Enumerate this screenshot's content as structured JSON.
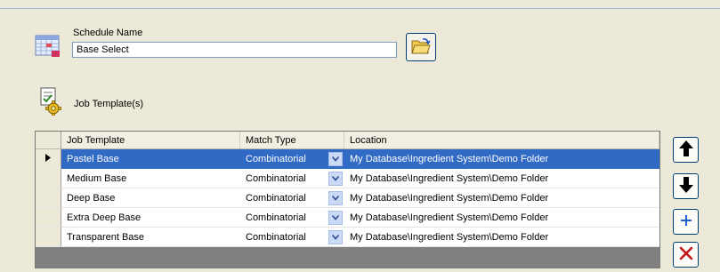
{
  "schedule": {
    "label": "Schedule Name",
    "value": "Base Select"
  },
  "job_templates": {
    "label": "Job Template(s)"
  },
  "grid": {
    "columns": [
      "Job Template",
      "Match Type",
      "Location"
    ],
    "rows": [
      {
        "template": "Pastel Base",
        "match": "Combinatorial",
        "location": "My Database\\Ingredient System\\Demo Folder",
        "selected": true
      },
      {
        "template": "Medium Base",
        "match": "Combinatorial",
        "location": "My Database\\Ingredient System\\Demo Folder",
        "selected": false
      },
      {
        "template": "Deep Base",
        "match": "Combinatorial",
        "location": "My Database\\Ingredient System\\Demo Folder",
        "selected": false
      },
      {
        "template": "Extra Deep Base",
        "match": "Combinatorial",
        "location": "My Database\\Ingredient System\\Demo Folder",
        "selected": false
      },
      {
        "template": "Transparent Base",
        "match": "Combinatorial",
        "location": "My Database\\Ingredient System\\Demo Folder",
        "selected": false
      }
    ]
  },
  "icons": {
    "schedule": "calendar-icon",
    "browse": "folder-open-icon",
    "job": "job-gear-icon",
    "row_pointer": "row-pointer-icon",
    "dropdown": "chevron-down-icon",
    "move_up": "arrow-up-icon",
    "move_down": "arrow-down-icon",
    "add": "plus-icon",
    "remove": "delete-x-icon"
  },
  "colors": {
    "selection": "#316ac5",
    "background": "#ece9d8",
    "add_icon": "#1f5fd1",
    "remove_icon": "#c01818"
  }
}
